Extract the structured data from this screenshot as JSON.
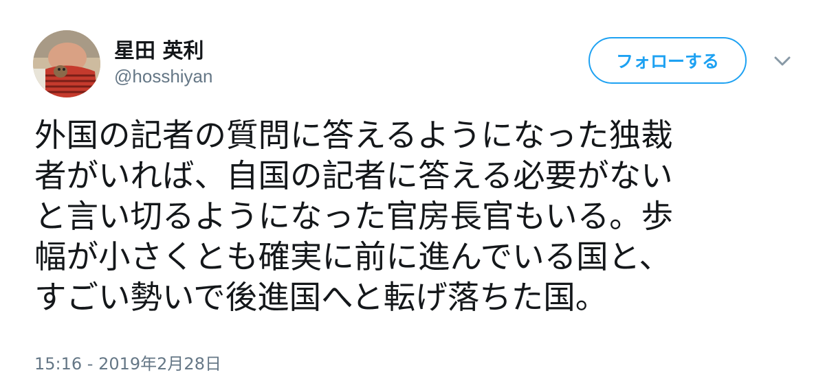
{
  "author": {
    "display_name": "星田 英利",
    "handle": "@hosshiyan",
    "avatar_icon": "avatar-photo"
  },
  "actions": {
    "follow_label": "フォローする",
    "menu_icon": "chevron-down-icon"
  },
  "tweet": {
    "lines": [
      "外国の記者の質問に答えるようになった独裁",
      "者がいれば、自国の記者に答える必要がない",
      "と言い切るようになった官房長官もいる。歩",
      "幅が小さくとも確実に前に進んでいる国と、",
      "すごい勢いで後進国へと転げ落ちた国。"
    ],
    "timestamp": "15:16 - 2019年2月28日"
  },
  "colors": {
    "accent": "#1da1f2",
    "text": "#14171a",
    "secondary": "#657786"
  }
}
